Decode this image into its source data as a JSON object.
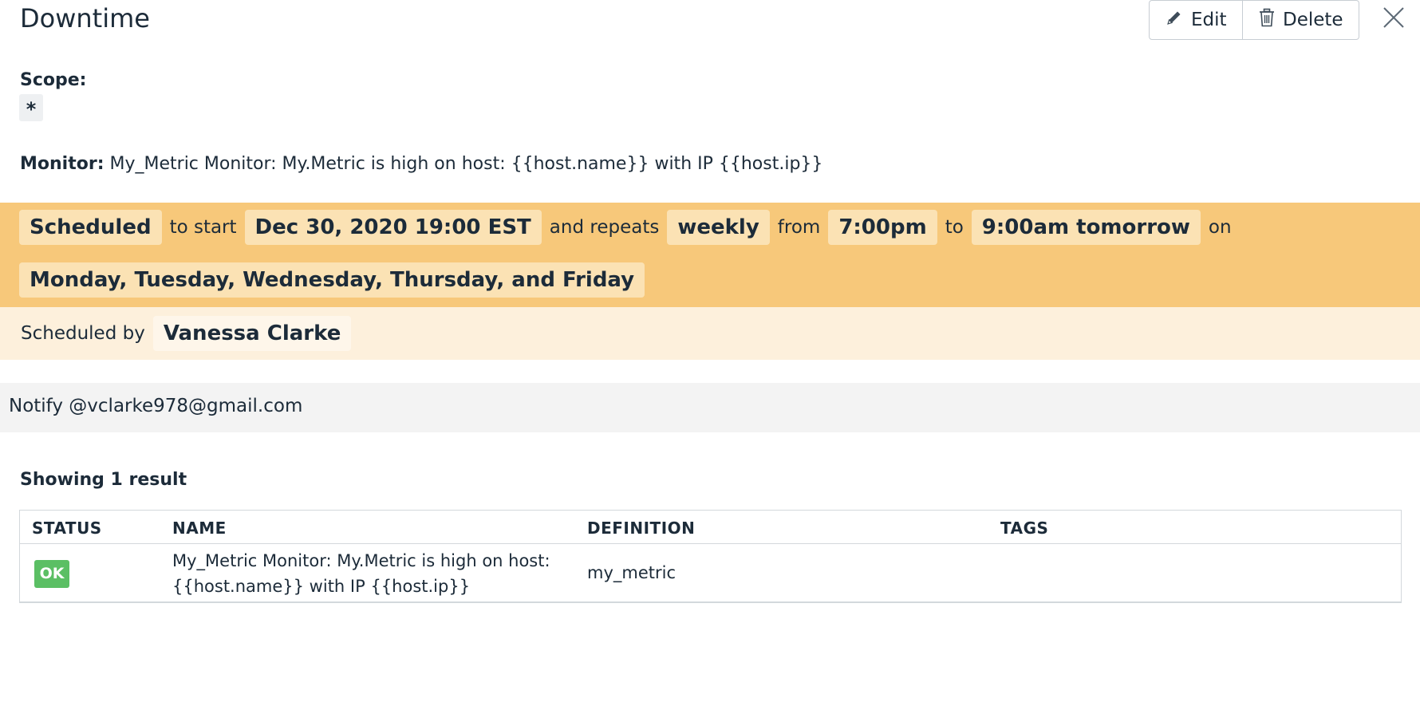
{
  "header": {
    "title": "Downtime",
    "edit_label": "Edit",
    "delete_label": "Delete"
  },
  "scope": {
    "label": "Scope:",
    "value": "*"
  },
  "monitor": {
    "label": "Monitor:",
    "value": "My_Metric Monitor: My.Metric is high on host: {{host.name}} with IP {{host.ip}}"
  },
  "schedule": {
    "status": "Scheduled",
    "to_start_text": "to start",
    "start": "Dec 30, 2020 19:00 EST",
    "and_repeats_text": "and repeats",
    "frequency": "weekly",
    "from_text": "from",
    "from_time": "7:00pm",
    "to_text": "to",
    "to_time": "9:00am tomorrow",
    "on_text": "on",
    "days": "Monday, Tuesday, Wednesday, Thursday, and Friday"
  },
  "scheduled_by": {
    "label": "Scheduled by",
    "name": "Vanessa Clarke"
  },
  "notify": {
    "text": "Notify @vclarke978@gmail.com"
  },
  "results": {
    "summary": "Showing 1 result",
    "columns": [
      "STATUS",
      "NAME",
      "DEFINITION",
      "TAGS"
    ],
    "rows": [
      {
        "status": "OK",
        "name": "My_Metric Monitor: My.Metric is high on host: {{host.name}} with IP {{host.ip}}",
        "definition": "my_metric",
        "tags": ""
      }
    ]
  },
  "colors": {
    "schedule_band": "#f7c87a",
    "scheduled_by_band": "#fdf0dc",
    "notify_band": "#f3f3f3",
    "ok_badge": "#5bbf64"
  },
  "icons": {
    "edit": "pencil-icon",
    "delete": "trash-icon",
    "close": "close-icon"
  }
}
